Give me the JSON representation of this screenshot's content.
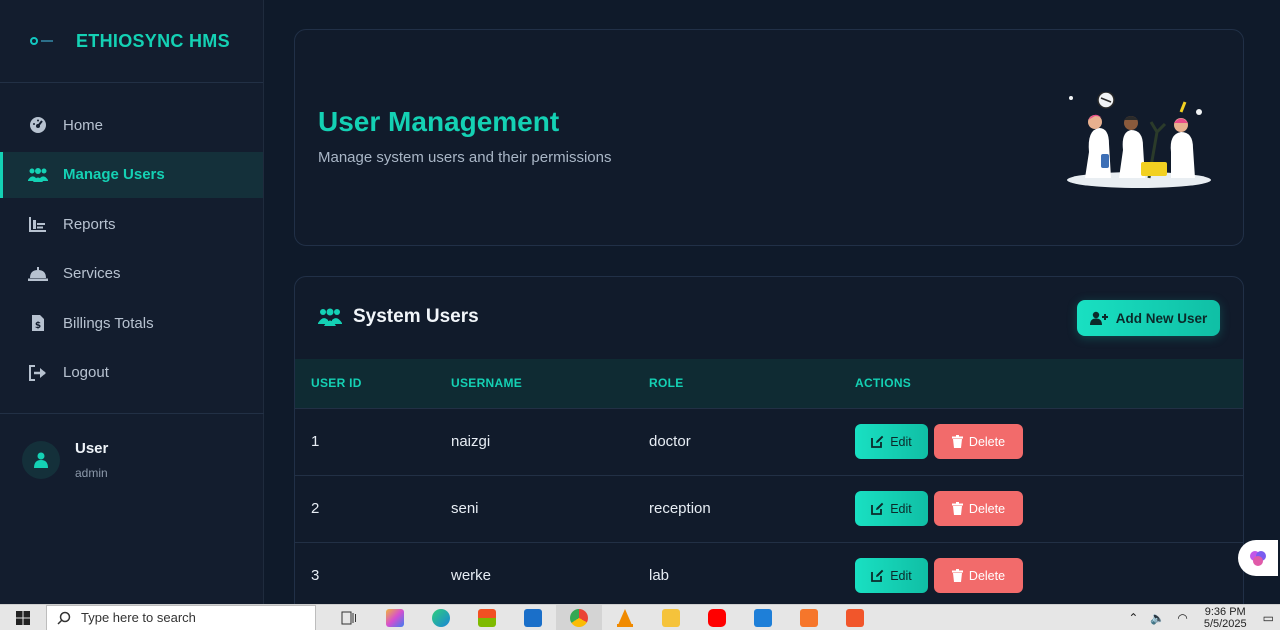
{
  "app": {
    "brand": "ETHIOSYNC HMS"
  },
  "sidebar": {
    "items": [
      {
        "label": "Home",
        "icon": "dashboard-icon",
        "active": false
      },
      {
        "label": "Manage Users",
        "icon": "users-icon",
        "active": true
      },
      {
        "label": "Reports",
        "icon": "chart-icon",
        "active": false
      },
      {
        "label": "Services",
        "icon": "bell-icon",
        "active": false
      },
      {
        "label": "Billings Totals",
        "icon": "invoice-icon",
        "active": false
      },
      {
        "label": "Logout",
        "icon": "logout-icon",
        "active": false
      }
    ],
    "user": {
      "name": "User",
      "role": "admin"
    }
  },
  "hero": {
    "title": "User Management",
    "subtitle": "Manage system users and their permissions"
  },
  "users_card": {
    "title": "System Users",
    "add_button": "Add New User",
    "columns": [
      "USER ID",
      "USERNAME",
      "ROLE",
      "ACTIONS"
    ],
    "rows": [
      {
        "id": "1",
        "username": "naizgi",
        "role": "doctor"
      },
      {
        "id": "2",
        "username": "seni",
        "role": "reception"
      },
      {
        "id": "3",
        "username": "werke",
        "role": "lab"
      }
    ],
    "edit_label": "Edit",
    "delete_label": "Delete"
  },
  "taskbar": {
    "search_placeholder": "Type here to search",
    "time": "9:36 PM",
    "date": "5/5/2025"
  },
  "colors": {
    "accent": "#14d1b4",
    "danger": "#f26b6b",
    "background": "#0f1a2a"
  }
}
